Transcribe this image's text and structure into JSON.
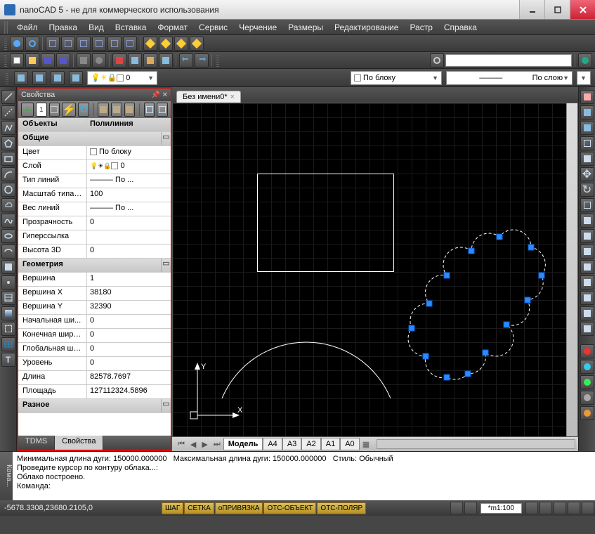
{
  "window": {
    "title": "nanoCAD 5 - не для коммерческого использования"
  },
  "menu": [
    "Файл",
    "Правка",
    "Вид",
    "Вставка",
    "Формат",
    "Сервис",
    "Черчение",
    "Размеры",
    "Редактирование",
    "Растр",
    "Справка"
  ],
  "dropdowns": {
    "layer": "0",
    "linetype_by": "По блоку",
    "linetype_layer": "По слою"
  },
  "document": {
    "tab": "Без имени0*"
  },
  "properties": {
    "title": "Свойства",
    "header": {
      "objects": "Объекты",
      "type": "Полилиния"
    },
    "sections": {
      "general": {
        "title": "Общие",
        "rows": [
          {
            "k": "Цвет",
            "v": "По блоку",
            "swatch": true
          },
          {
            "k": "Слой",
            "v": "0",
            "icons": true
          },
          {
            "k": "Тип линий",
            "v": "——— По ..."
          },
          {
            "k": "Масштаб типа ...",
            "v": "100"
          },
          {
            "k": "Вес линий",
            "v": "——— По ..."
          },
          {
            "k": "Прозрачность",
            "v": "0"
          },
          {
            "k": "Гиперссылка",
            "v": ""
          },
          {
            "k": "Высота 3D",
            "v": "0"
          }
        ]
      },
      "geometry": {
        "title": "Геометрия",
        "rows": [
          {
            "k": "Вершина",
            "v": "1"
          },
          {
            "k": "Вершина X",
            "v": "38180"
          },
          {
            "k": "Вершина Y",
            "v": "32390"
          },
          {
            "k": "Начальная ши...",
            "v": "0"
          },
          {
            "k": "Конечная шири...",
            "v": "0"
          },
          {
            "k": "Глобальная ши...",
            "v": "0"
          },
          {
            "k": "Уровень",
            "v": "0"
          },
          {
            "k": "Длина",
            "v": "82578.7697"
          },
          {
            "k": "Площадь",
            "v": "127112324.5896"
          }
        ]
      },
      "misc": {
        "title": "Разное"
      }
    },
    "tabs": [
      "TDMS",
      "Свойства"
    ],
    "active_tab": 1
  },
  "model_tabs": {
    "items": [
      "Модель",
      "А4",
      "А3",
      "А2",
      "А1",
      "А0"
    ],
    "active": 0
  },
  "command": {
    "label": "Кома...",
    "lines": [
      "Минимальная длина дуги: 150000.000000   Максимальная длина дуги: 150000.000000   Стиль: Обычный",
      "Проведите курсор по контуру облака...:",
      "Облако построено."
    ],
    "prompt": "Команда:"
  },
  "status": {
    "coords": "-5678.3308,23680.2105,0",
    "toggles": [
      "ШАГ",
      "СЕТКА",
      "оПРИВЯЗКА",
      "ОТС-ОБЪЕКТ",
      "ОТС-ПОЛЯР"
    ],
    "scale": "*m1:100"
  }
}
